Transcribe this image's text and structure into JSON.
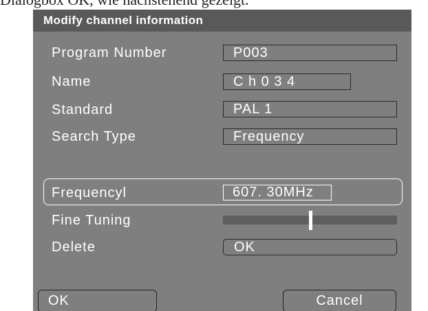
{
  "above_text": "Dialogbox OK, wie nachstehend gezeigt.",
  "dialog": {
    "title": "Modify channel information",
    "fields": {
      "program_number": {
        "label": "Program Number",
        "value": "P003"
      },
      "name": {
        "label": "Name",
        "value": "C h 0 3 4"
      },
      "standard": {
        "label": "Standard",
        "value": "PAL 1"
      },
      "search_type": {
        "label": "Search Type",
        "value": "Frequency"
      },
      "frequency": {
        "label": "Frequencyl",
        "value": "607. 30MHz"
      },
      "fine_tuning": {
        "label": "Fine Tuning",
        "level": 0.5
      },
      "delete": {
        "label": "Delete",
        "value": "OK"
      }
    },
    "buttons": {
      "ok": "OK",
      "cancel": "Cancel"
    }
  },
  "colors": {
    "dialog_bg": "#7f7f7f",
    "header_bg": "#595959",
    "slider_track": "#5e5e5e",
    "text": "#ffffff"
  }
}
